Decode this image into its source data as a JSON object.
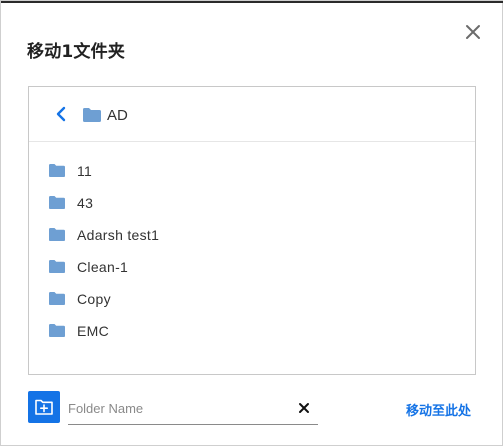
{
  "dialog": {
    "title": "移动1文件夹",
    "close_icon": "close-icon"
  },
  "browser": {
    "current_folder": "AD",
    "back_icon": "chevron-left-icon",
    "folder_icon": "folder-icon",
    "items": [
      {
        "name": "11"
      },
      {
        "name": "43"
      },
      {
        "name": "Adarsh test1"
      },
      {
        "name": "Clean-1"
      },
      {
        "name": "Copy"
      },
      {
        "name": "EMC"
      }
    ]
  },
  "footer": {
    "new_folder_icon": "new-folder-icon",
    "folder_name_placeholder": "Folder Name",
    "folder_name_value": "",
    "clear_icon": "close-icon",
    "move_here_label": "移动至此处"
  },
  "colors": {
    "accent": "#1473e6",
    "folder": "#6e9fd3"
  }
}
